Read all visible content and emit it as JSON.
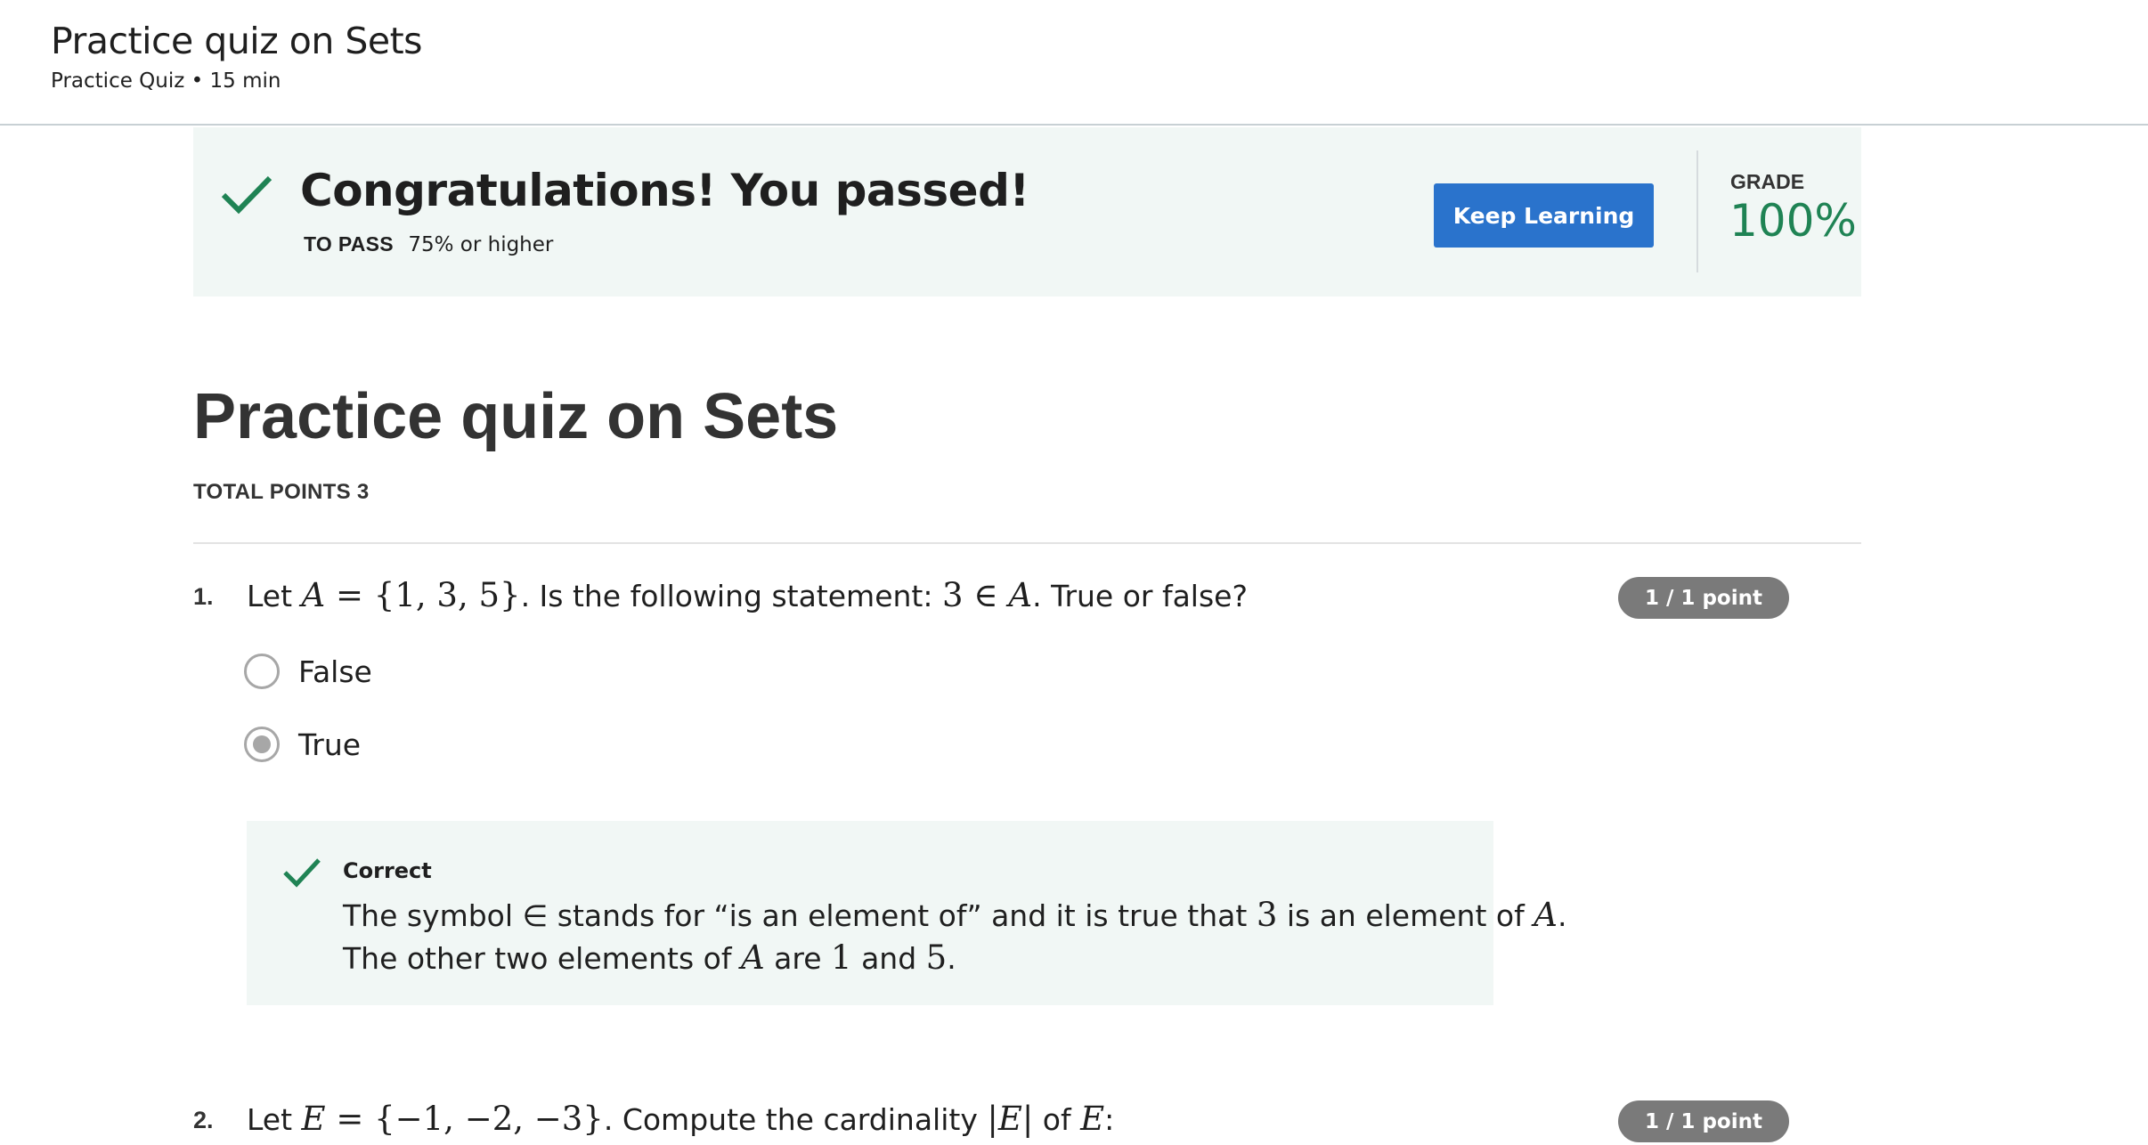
{
  "header": {
    "title": "Practice quiz on Sets",
    "subtitle": "Practice Quiz • 15 min"
  },
  "banner": {
    "headline": "Congratulations! You passed!",
    "to_pass_label": "TO PASS",
    "to_pass_value": "75% or higher",
    "button_label": "Keep Learning",
    "grade_label": "GRADE",
    "grade_value": "100%",
    "accent_color": "#1f8354",
    "button_color": "#2a73cc"
  },
  "quiz": {
    "title": "Practice quiz on Sets",
    "total_points": "TOTAL POINTS 3"
  },
  "questions": [
    {
      "number": "1.",
      "text_parts": [
        "Let ",
        "A",
        " = {1, 3, 5}",
        ". Is the following statement: ",
        "3 ∈ ",
        "A",
        ". True or false?"
      ],
      "points": "1 / 1 point",
      "options": [
        {
          "label": "False",
          "selected": false
        },
        {
          "label": "True",
          "selected": true
        }
      ],
      "feedback": {
        "title": "Correct",
        "line1_parts": [
          "The symbol ∈ stands for “is an element of” and it is true that ",
          "3",
          " is an element of ",
          "A",
          "."
        ],
        "line2_parts": [
          "The other two elements of ",
          "A",
          " are ",
          "1",
          " and ",
          "5",
          "."
        ]
      }
    },
    {
      "number": "2.",
      "text_parts": [
        "Let ",
        "E",
        " = {−1, −2, −3}",
        ". Compute the cardinality ",
        "|",
        "E",
        "|",
        " of ",
        "E",
        ":"
      ],
      "points": "1 / 1 point"
    }
  ]
}
